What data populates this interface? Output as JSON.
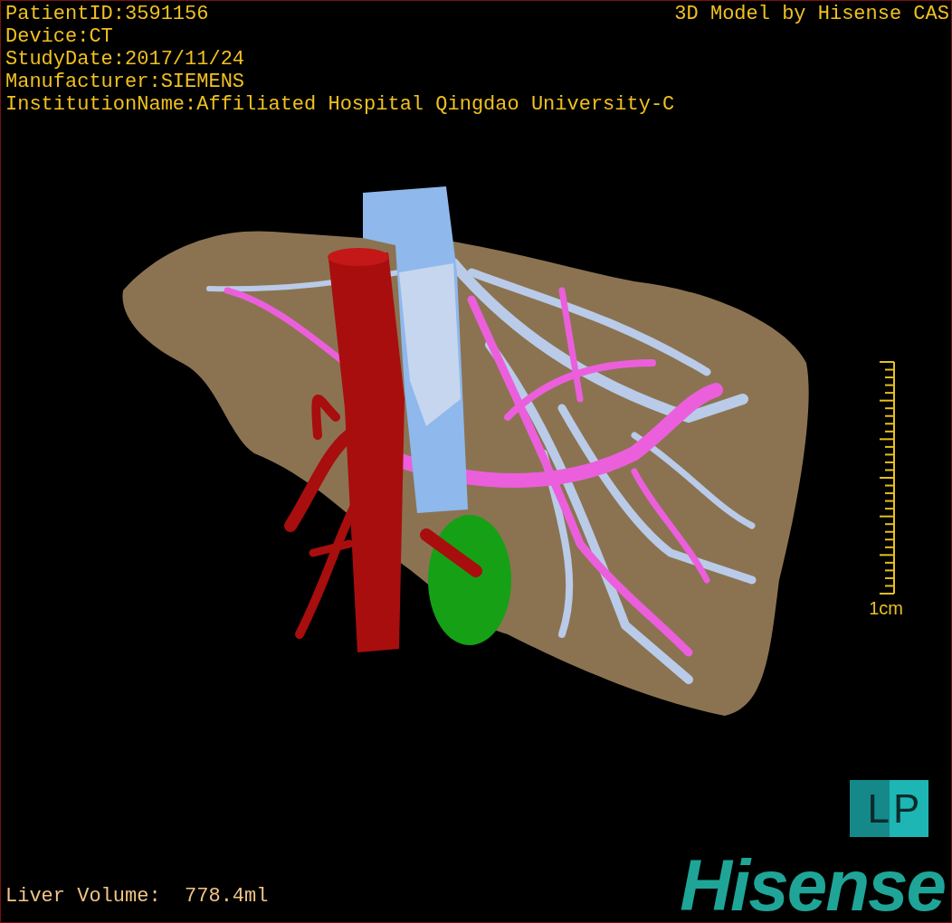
{
  "info_lines": [
    "PatientID:3591156",
    "Device:CT",
    "StudyDate:2017/11/24",
    "Manufacturer:SIEMENS",
    "InstitutionName:Affiliated Hospital Qingdao University-C"
  ],
  "title": "3D Model by Hisense CAS",
  "scale_bar": {
    "label": "1cm"
  },
  "orientation_marker": {
    "left": "L",
    "right": "P"
  },
  "liver_volume": "Liver Volume:  778.4ml",
  "logo": "Hisense"
}
